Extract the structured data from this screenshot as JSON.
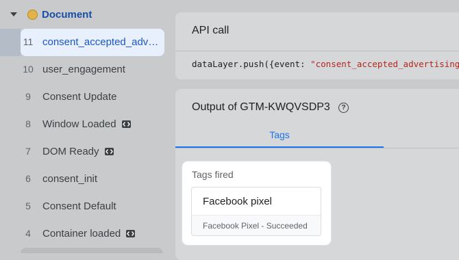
{
  "sidebar": {
    "document_label": "Document",
    "events": [
      {
        "num": "11",
        "name": "consent_accepted_advertising",
        "selected": true,
        "code_icon": false
      },
      {
        "num": "10",
        "name": "user_engagement",
        "selected": false,
        "code_icon": false
      },
      {
        "num": "9",
        "name": "Consent Update",
        "selected": false,
        "code_icon": false
      },
      {
        "num": "8",
        "name": "Window Loaded",
        "selected": false,
        "code_icon": true
      },
      {
        "num": "7",
        "name": "DOM Ready",
        "selected": false,
        "code_icon": true
      },
      {
        "num": "6",
        "name": "consent_init",
        "selected": false,
        "code_icon": false
      },
      {
        "num": "5",
        "name": "Consent Default",
        "selected": false,
        "code_icon": false
      },
      {
        "num": "4",
        "name": "Container loaded",
        "selected": false,
        "code_icon": true
      }
    ]
  },
  "api_call": {
    "title": "API call",
    "code_prefix": "dataLayer.push({event: ",
    "code_string": "\"consent_accepted_advertising\"})"
  },
  "output": {
    "title": "Output of GTM-KWQVSDP3",
    "tab_label": "Tags",
    "tags_fired_title": "Tags fired",
    "tag_name": "Facebook pixel",
    "tag_status": "Facebook Pixel - Succeeded"
  },
  "colors": {
    "accent": "#1a73e8",
    "selected_bg": "#e8f0fe",
    "doc_dot": "#e2b34a",
    "string_red": "#b3261e"
  }
}
